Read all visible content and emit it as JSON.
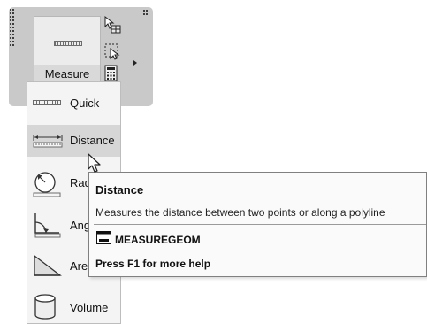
{
  "ribbon": {
    "measure_button": {
      "label": "Measure",
      "icon": "ruler-icon"
    },
    "side_tools": [
      {
        "name": "select-similar-icon"
      },
      {
        "name": "quick-select-icon"
      },
      {
        "name": "calculator-icon"
      }
    ],
    "panel_expand_icon": "expand-arrow-icon"
  },
  "dropdown": {
    "items": [
      {
        "label": "Quick",
        "icon": "ruler-icon"
      },
      {
        "label": "Distance",
        "icon": "distance-icon",
        "highlighted": true
      },
      {
        "label": "Rad",
        "icon": "radius-icon"
      },
      {
        "label": "Ang",
        "icon": "angle-icon"
      },
      {
        "label": "Area",
        "icon": "area-icon"
      },
      {
        "label": "Volume",
        "icon": "volume-icon"
      }
    ]
  },
  "tooltip": {
    "title": "Distance",
    "description": "Measures the distance between two points or along a polyline",
    "command": "MEASUREGEOM",
    "help": "Press F1 for more help"
  },
  "colors": {
    "panel_bg": "#c9c9c9",
    "menu_bg": "#f4f4f4",
    "menu_hover": "#d6d6d6",
    "tooltip_border": "#808080"
  }
}
